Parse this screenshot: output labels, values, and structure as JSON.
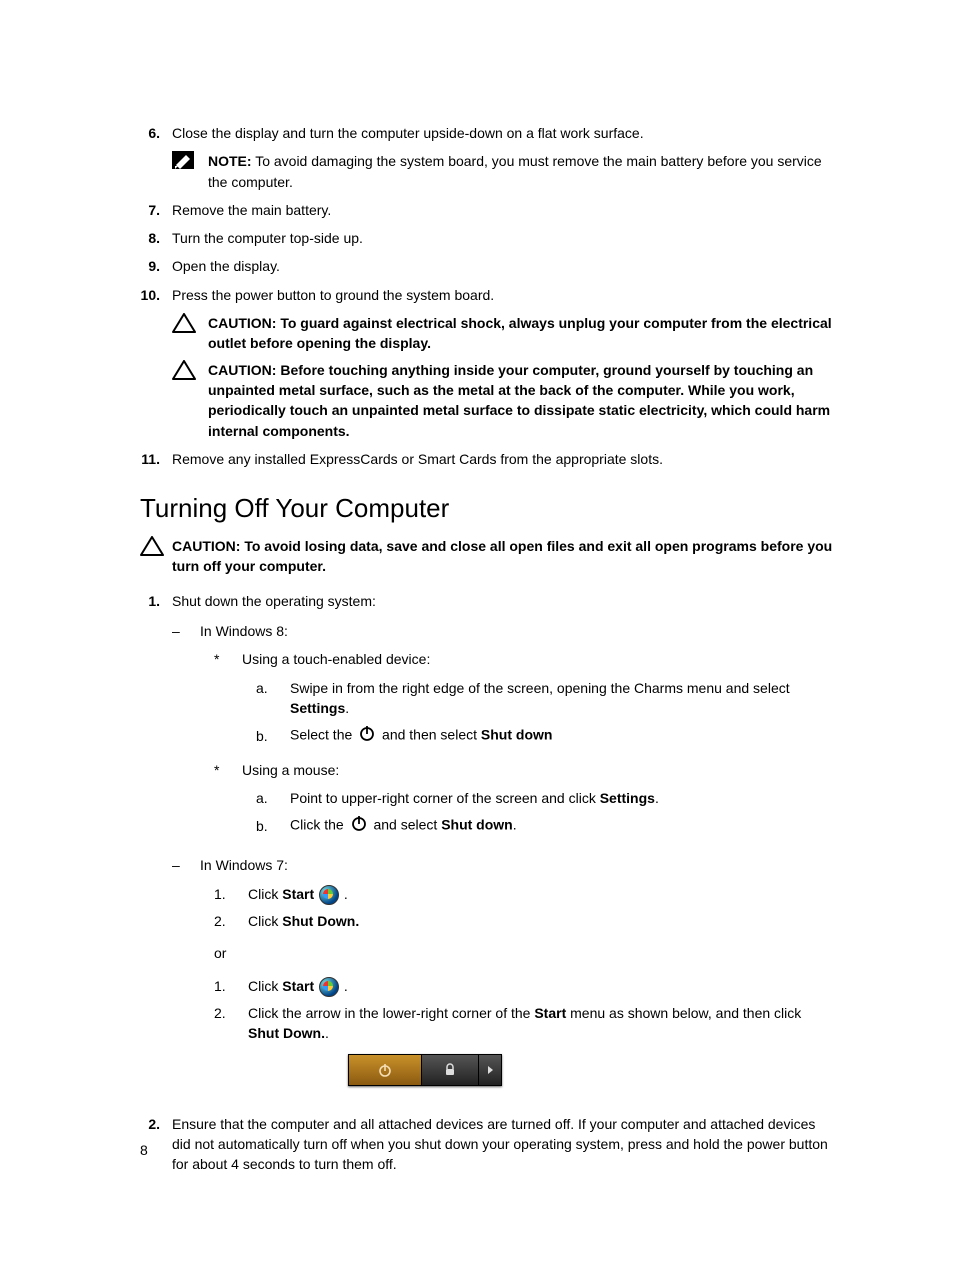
{
  "step6": {
    "num": "6.",
    "text": "Close the display and turn the computer upside-down on a flat work surface."
  },
  "note6": {
    "label": "NOTE:",
    "text": " To avoid damaging the system board, you must remove the main battery before you service the computer."
  },
  "step7": {
    "num": "7.",
    "text": "Remove the main battery."
  },
  "step8": {
    "num": "8.",
    "text": "Turn the computer top-side up."
  },
  "step9": {
    "num": "9.",
    "text": "Open the display."
  },
  "step10": {
    "num": "10.",
    "text": "Press the power button to ground the system board."
  },
  "caution10a": {
    "label": "CAUTION: ",
    "text": "To guard against electrical shock, always unplug your computer from the electrical outlet before opening the display."
  },
  "caution10b": {
    "label": "CAUTION: ",
    "text": "Before touching anything inside your computer, ground yourself by touching an unpainted metal surface, such as the metal at the back of the computer. While you work, periodically touch an unpainted metal surface to dissipate static electricity, which could harm internal components."
  },
  "step11": {
    "num": "11.",
    "text": "Remove any installed ExpressCards or Smart Cards from the appropriate slots."
  },
  "heading": "Turning Off Your Computer",
  "cautionHead": {
    "label": "CAUTION: ",
    "text": "To avoid losing data, save and close all open files and exit all open programs before you turn off your computer."
  },
  "s1": {
    "num": "1.",
    "text": "Shut down the operating system:"
  },
  "w8": "In Windows 8:",
  "touch": "Using a touch-enabled device:",
  "t_a_pre": "Swipe in from the right edge of the screen, opening the Charms menu and select ",
  "t_a_b": "Settings",
  "t_b_pre": "Select the ",
  "t_b_mid": " and then select ",
  "t_b_b": "Shut down",
  "mouse": "Using a mouse:",
  "m_a_pre": "Point to upper-right corner of the screen and click ",
  "m_a_b": "Settings",
  "m_b_pre": "Click the ",
  "m_b_mid": " and select ",
  "m_b_b": "Shut down",
  "w7": "In Windows 7:",
  "w7_1_pre": "Click ",
  "w7_1_b": "Start",
  "w7_2_pre": "Click ",
  "w7_2_b": "Shut Down.",
  "or": "or",
  "w7b_1_pre": "Click ",
  "w7b_1_b": "Start",
  "w7b_2_pre": "Click the arrow in the lower-right corner of the ",
  "w7b_2_b1": "Start",
  "w7b_2_mid": " menu as shown below, and then click ",
  "w7b_2_b2": "Shut Down.",
  "s2": {
    "num": "2.",
    "text": "Ensure that the computer and all attached devices are turned off. If your computer and attached devices did not automatically turn off when you shut down your operating system, press and hold the power button for about 4 seconds to turn them off."
  },
  "pageNumber": "8",
  "letters": {
    "a": "a.",
    "b": "b."
  },
  "nums": {
    "one": "1.",
    "two": "2."
  },
  "dash": "–",
  "star": "*",
  "dot": "."
}
